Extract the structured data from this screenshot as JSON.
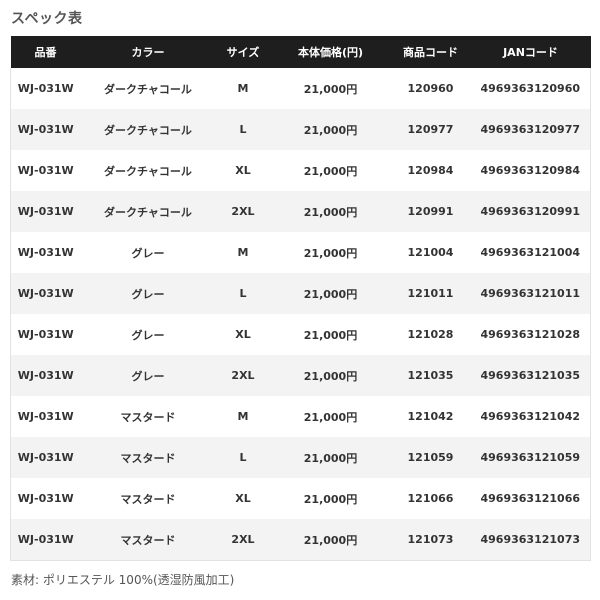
{
  "title": "スペック表",
  "table": {
    "headers": [
      "品番",
      "カラー",
      "サイズ",
      "本体価格(円)",
      "商品コード",
      "JANコード"
    ],
    "rows": [
      [
        "WJ-031W",
        "ダークチャコール",
        "M",
        "21,000円",
        "120960",
        "4969363120960"
      ],
      [
        "WJ-031W",
        "ダークチャコール",
        "L",
        "21,000円",
        "120977",
        "4969363120977"
      ],
      [
        "WJ-031W",
        "ダークチャコール",
        "XL",
        "21,000円",
        "120984",
        "4969363120984"
      ],
      [
        "WJ-031W",
        "ダークチャコール",
        "2XL",
        "21,000円",
        "120991",
        "4969363120991"
      ],
      [
        "WJ-031W",
        "グレー",
        "M",
        "21,000円",
        "121004",
        "4969363121004"
      ],
      [
        "WJ-031W",
        "グレー",
        "L",
        "21,000円",
        "121011",
        "4969363121011"
      ],
      [
        "WJ-031W",
        "グレー",
        "XL",
        "21,000円",
        "121028",
        "4969363121028"
      ],
      [
        "WJ-031W",
        "グレー",
        "2XL",
        "21,000円",
        "121035",
        "4969363121035"
      ],
      [
        "WJ-031W",
        "マスタード",
        "M",
        "21,000円",
        "121042",
        "4969363121042"
      ],
      [
        "WJ-031W",
        "マスタード",
        "L",
        "21,000円",
        "121059",
        "4969363121059"
      ],
      [
        "WJ-031W",
        "マスタード",
        "XL",
        "21,000円",
        "121066",
        "4969363121066"
      ],
      [
        "WJ-031W",
        "マスタード",
        "2XL",
        "21,000円",
        "121073",
        "4969363121073"
      ]
    ]
  },
  "note": "素材: ポリエステル 100%(透湿防風加工)",
  "colors": {
    "header_bg": "#1e1e1e",
    "header_text": "#ffffff",
    "row_alt_bg": "#f3f3f3",
    "text": "#333333"
  }
}
